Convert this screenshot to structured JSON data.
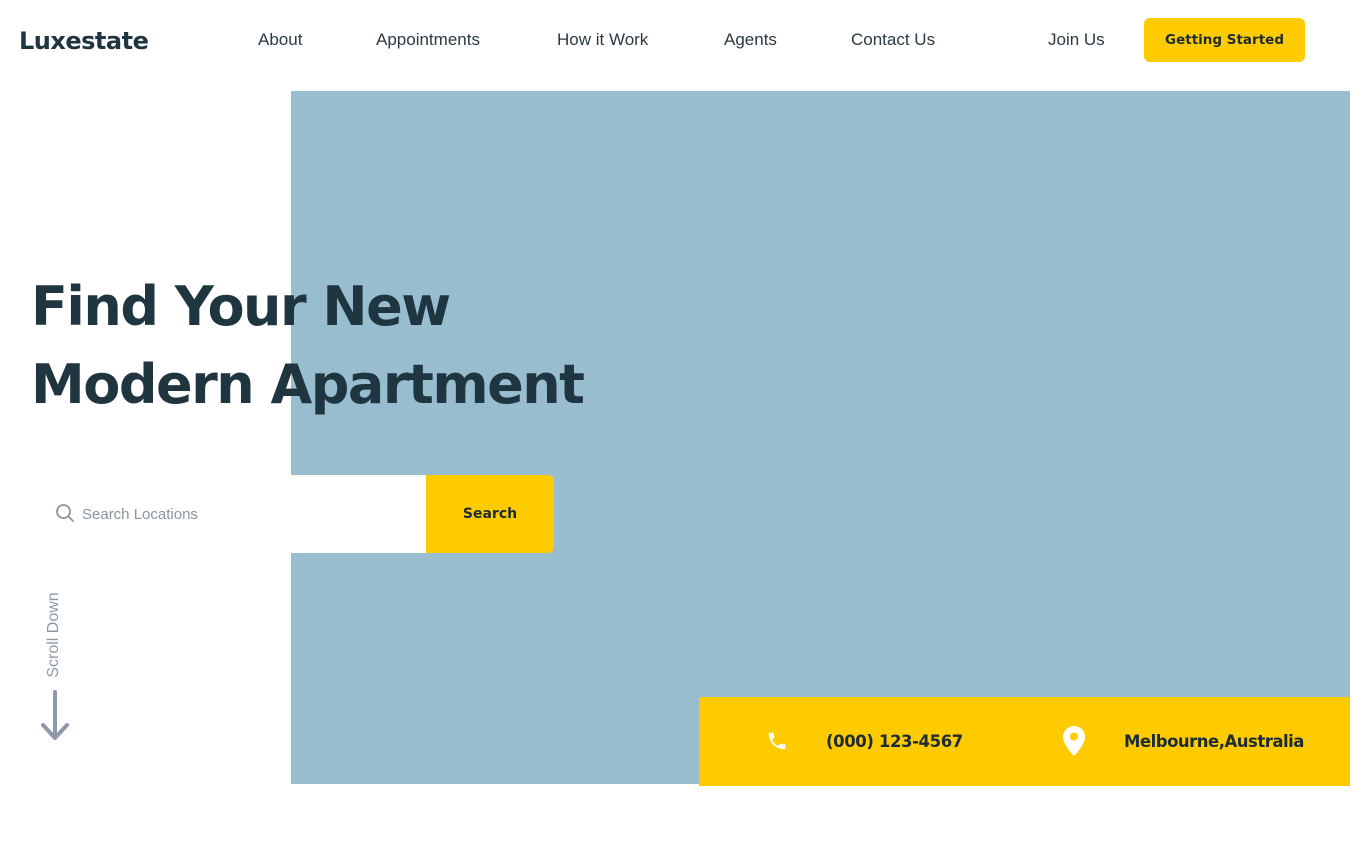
{
  "brand": {
    "name": "Luxestate"
  },
  "nav": {
    "items": [
      {
        "label": "About"
      },
      {
        "label": "Appointments"
      },
      {
        "label": "How it Work"
      },
      {
        "label": "Agents"
      },
      {
        "label": "Contact Us"
      }
    ],
    "join_label": "Join Us",
    "cta_label": "Getting Started"
  },
  "hero": {
    "title_line1": "Find Your New",
    "title_line2": "Modern Apartment",
    "image_icon": "hero-image-placeholder"
  },
  "search": {
    "placeholder": "Search Locations",
    "value": "",
    "button_label": "Search",
    "icon": "search-icon"
  },
  "scroll": {
    "label": "Scroll Down",
    "icon": "arrow-down-icon"
  },
  "contact": {
    "phone": "(000) 123-4567",
    "phone_icon": "phone-icon",
    "location": "Melbourne,Australia",
    "location_icon": "location-pin-icon"
  },
  "colors": {
    "accent": "#fecb00",
    "heading": "#1f3540",
    "hero_bg": "#97bdcf",
    "muted": "#8d99a8"
  }
}
